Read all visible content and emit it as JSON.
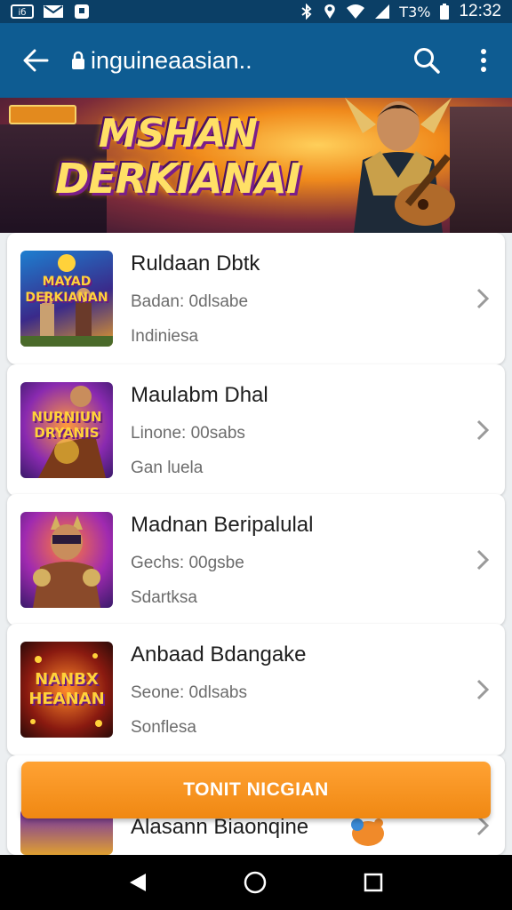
{
  "status_bar": {
    "left_icons": [
      "notification-icon",
      "mail-icon",
      "shield-icon"
    ],
    "battery": "T3%",
    "time": "12:32"
  },
  "app_bar": {
    "title": "inguineaasian..",
    "icons": [
      "back-arrow-icon",
      "lock-icon",
      "search-icon",
      "more-vert-icon"
    ]
  },
  "banner": {
    "badge": "",
    "title_line1": "MSHAN",
    "title_line2": "DERKIANAI"
  },
  "items": [
    {
      "title": "Ruldaan Dbtk",
      "subtitle": "Badan: 0dlsabe",
      "meta": "Indiniesa",
      "thumb_text": "MAYAD DERKIANAN",
      "thumb_colors": [
        "#2a8fd6",
        "#e9a13a"
      ]
    },
    {
      "title": "Maulabm Dhal",
      "subtitle": "Linone: 00sabs",
      "meta": "Gan luela",
      "thumb_text": "NURNIUN DRYANIS",
      "thumb_colors": [
        "#5a2aa0",
        "#d23a7a"
      ]
    },
    {
      "title": "Madnan Beripalulal",
      "subtitle": "Gechs: 00gsbe",
      "meta": "Sdartksa",
      "thumb_text": "",
      "thumb_colors": [
        "#6a1fa0",
        "#f0672a"
      ]
    },
    {
      "title": "Anbaad Bdangake",
      "subtitle": "Seone: 0dlsabs",
      "meta": "Sonflesa",
      "thumb_text": "NANBX HEANAN",
      "thumb_colors": [
        "#3a1a10",
        "#d2501a"
      ]
    },
    {
      "title": "Alasann Biaonqine",
      "subtitle": "",
      "meta": "",
      "thumb_text": "",
      "thumb_colors": [
        "#6a2ab0",
        "#e0a030"
      ]
    }
  ],
  "cta": {
    "label": "TONIT NICGIAN"
  },
  "nav": {
    "icons": [
      "back-triangle-icon",
      "home-circle-icon",
      "recents-square-icon"
    ]
  },
  "colors": {
    "app_bar": "#0e5c92",
    "status_bar": "#0b3f66",
    "cta": "#f5921e"
  }
}
